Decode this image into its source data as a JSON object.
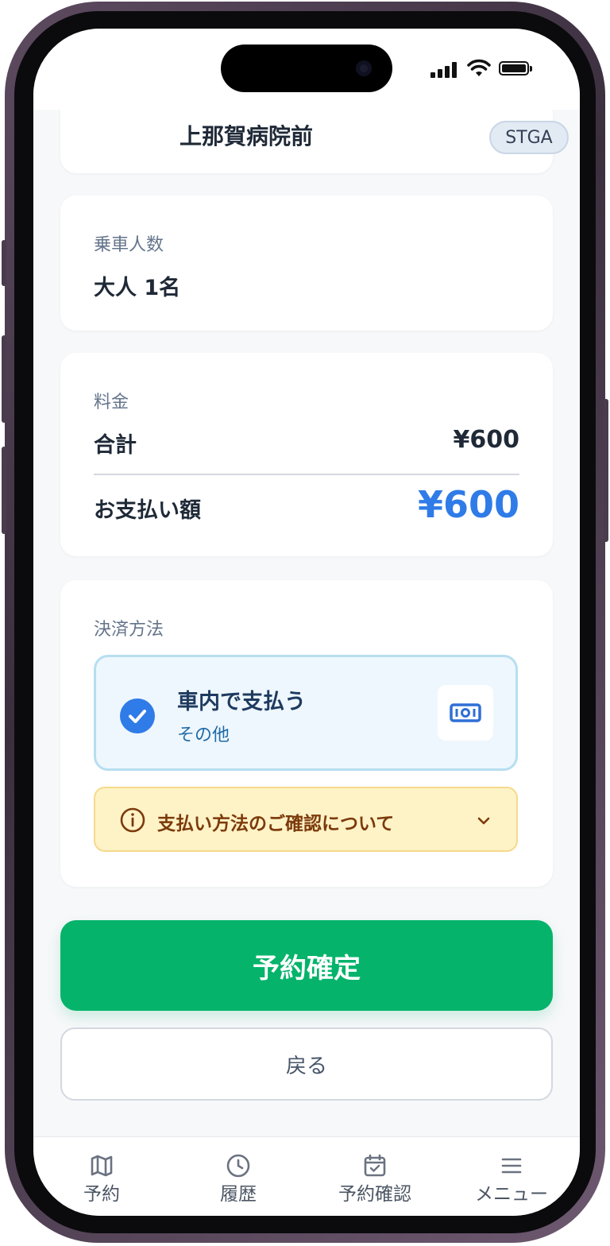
{
  "header": {
    "stop_name": "上那賀病院前",
    "env_badge": "STGA"
  },
  "passengers": {
    "label": "乗車人数",
    "value": "大人 1名"
  },
  "fare": {
    "label": "料金",
    "total_label": "合計",
    "total_value": "¥600",
    "payment_label": "お支払い額",
    "payment_value": "¥600"
  },
  "payment_method": {
    "label": "決済方法",
    "selected_title": "車内で支払う",
    "selected_sub": "その他",
    "notice_text": "支払い方法のご確認について"
  },
  "actions": {
    "confirm_label": "予約確定",
    "back_label": "戻る"
  },
  "tabbar": {
    "items": [
      {
        "label": "予約",
        "icon": "map-icon"
      },
      {
        "label": "履歴",
        "icon": "clock-icon"
      },
      {
        "label": "予約確認",
        "icon": "calendar-check-icon"
      },
      {
        "label": "メニュー",
        "icon": "menu-icon"
      }
    ]
  },
  "colors": {
    "accent_blue": "#2f7be8",
    "confirm_green": "#05b36b",
    "notice_bg": "#fef3c7",
    "notice_text": "#7c3a0b",
    "selected_bg": "#eef7fd"
  }
}
